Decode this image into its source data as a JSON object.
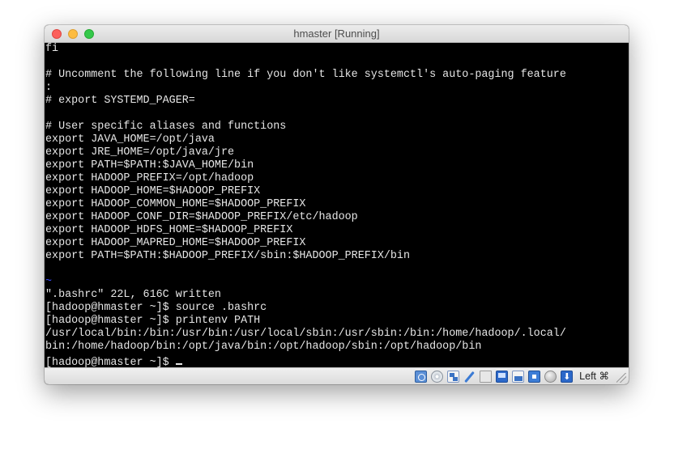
{
  "window": {
    "title": "hmaster [Running]"
  },
  "terminal": {
    "lines": [
      "fi",
      "",
      "# Uncomment the following line if you don't like systemctl's auto-paging feature",
      ":",
      "# export SYSTEMD_PAGER=",
      "",
      "# User specific aliases and functions",
      "export JAVA_HOME=/opt/java",
      "export JRE_HOME=/opt/java/jre",
      "export PATH=$PATH:$JAVA_HOME/bin",
      "export HADOOP_PREFIX=/opt/hadoop",
      "export HADOOP_HOME=$HADOOP_PREFIX",
      "export HADOOP_COMMON_HOME=$HADOOP_PREFIX",
      "export HADOOP_CONF_DIR=$HADOOP_PREFIX/etc/hadoop",
      "export HADOOP_HDFS_HOME=$HADOOP_PREFIX",
      "export HADOOP_MAPRED_HOME=$HADOOP_PREFIX",
      "export PATH=$PATH:$HADOOP_PREFIX/sbin:$HADOOP_PREFIX/bin",
      "",
      "~",
      "\".bashrc\" 22L, 616C written",
      "[hadoop@hmaster ~]$ source .bashrc",
      "[hadoop@hmaster ~]$ printenv PATH",
      "/usr/local/bin:/bin:/usr/bin:/usr/local/sbin:/usr/sbin:/bin:/home/hadoop/.local/",
      "bin:/home/hadoop/bin:/opt/java/bin:/opt/hadoop/sbin:/opt/hadoop/bin",
      "[hadoop@hmaster ~]$ "
    ]
  },
  "statusbar": {
    "icons": [
      "hard-disk-icon",
      "optical-drive-icon",
      "network-icon",
      "usb-icon",
      "shared-folders-icon",
      "display-icon",
      "network-adapter-icon",
      "cpu-icon",
      "mouse-integration-icon",
      "keyboard-capture-icon"
    ],
    "host_key": "Left ⌘"
  },
  "colors": {
    "terminal_bg": "#000000",
    "terminal_fg": "#e6e6e6",
    "vim_tilde": "#3a4cff",
    "close": "#fc605c",
    "minimize": "#fdbc40",
    "maximize": "#34c84a"
  }
}
